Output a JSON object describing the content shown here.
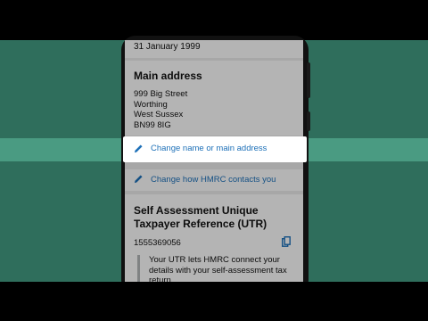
{
  "profile": {
    "date_of_birth": "31 January 1999",
    "main_address": {
      "heading": "Main address",
      "line1": "999 Big Street",
      "line2": "Worthing",
      "line3": "West Sussex",
      "postcode": "BN99 8IG"
    },
    "change_address_link": "Change name or main address",
    "change_contacts_link": "Change how HMRC contacts you",
    "utr": {
      "heading": "Self Assessment Unique Taxpayer Reference (UTR)",
      "number": "1555369056",
      "info": "Your UTR lets HMRC connect your details with your self-assessment tax return."
    }
  },
  "icons": {
    "edit": "pencil-icon",
    "copy": "copy-icon"
  },
  "colors": {
    "background": "#2f6e5c",
    "stripe": "#4a9b82",
    "link": "#1d70b8"
  }
}
